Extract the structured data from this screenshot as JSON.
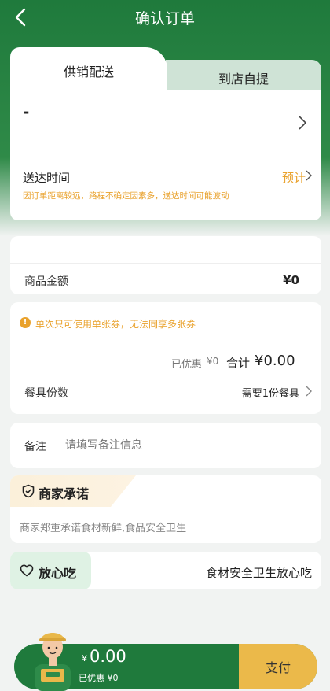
{
  "header": {
    "title": "确认订单"
  },
  "delivery": {
    "tab_active": "供销配送",
    "tab_inactive": "到店自提",
    "address": "-",
    "time_label": "送达时间",
    "time_estimate": "预计",
    "time_note": "因订单距离较远，路程不确定因素多，送达时间可能波动"
  },
  "order": {
    "amount_label": "商品金额",
    "amount_value": "¥0"
  },
  "coupon": {
    "note": "单次只可使用单张券，无法同享多张券",
    "discount_label": "已优惠",
    "discount_value": "¥0",
    "total_label": "合计",
    "total_value": "¥0.00",
    "tableware_label": "餐具份数",
    "tableware_value": "需要1份餐具"
  },
  "remark": {
    "label": "备注",
    "placeholder": "请填写备注信息"
  },
  "promise": {
    "title": "商家承诺",
    "text": "商家郑重承诺食材新鲜,食品安全卫生"
  },
  "safety": {
    "title": "放心吃",
    "text": "食材安全卫生放心吃"
  },
  "paybar": {
    "currency": "¥",
    "amount": "0.00",
    "discount": "已优惠 ¥0",
    "pay_label": "支付"
  },
  "colors": {
    "brand_green": "#1f7a3c",
    "accent_orange": "#e9a12b",
    "pay_yellow": "#ebb94a"
  }
}
